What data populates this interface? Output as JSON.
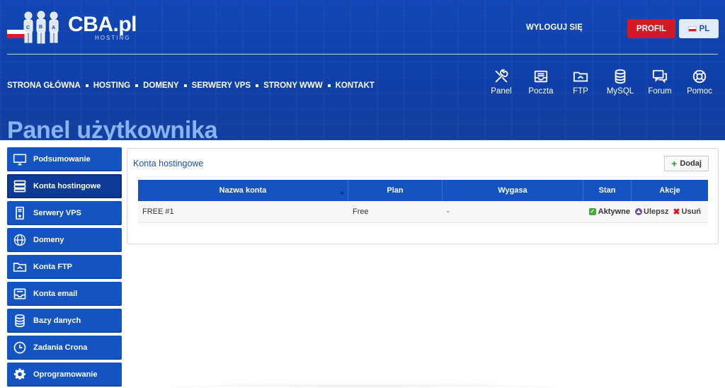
{
  "header": {
    "logo_text": "CBA.pl",
    "logo_sub": "HOSTING",
    "logout_label": "WYLOGUJ SIĘ",
    "profile_label": "PROFIL",
    "lang_label": "PL"
  },
  "nav": {
    "items": [
      "STRONA GŁÓWNA",
      "HOSTING",
      "DOMENY",
      "SERWERY VPS",
      "STRONY WWW",
      "KONTAKT"
    ]
  },
  "quick_links": [
    {
      "label": "Panel",
      "icon": "tools-icon"
    },
    {
      "label": "Poczta",
      "icon": "mail-icon"
    },
    {
      "label": "FTP",
      "icon": "folder-icon"
    },
    {
      "label": "MySQL",
      "icon": "database-icon"
    },
    {
      "label": "Forum",
      "icon": "chat-icon"
    },
    {
      "label": "Pomoc",
      "icon": "lifebuoy-icon"
    }
  ],
  "page_title": "Panel użytkownika",
  "sidebar": {
    "items": [
      {
        "label": "Podsumowanie",
        "icon": "monitor-icon"
      },
      {
        "label": "Konta hostingowe",
        "icon": "server-icon",
        "active": true
      },
      {
        "label": "Serwery VPS",
        "icon": "tower-icon"
      },
      {
        "label": "Domeny",
        "icon": "www-icon"
      },
      {
        "label": "Konta FTP",
        "icon": "folder-icon"
      },
      {
        "label": "Konta email",
        "icon": "mail-icon"
      },
      {
        "label": "Bazy danych",
        "icon": "database-icon"
      },
      {
        "label": "Zadania Crona",
        "icon": "clock-icon"
      },
      {
        "label": "Oprogramowanie",
        "icon": "gear-icon"
      }
    ]
  },
  "panel": {
    "title": "Konta hostingowe",
    "add_label": "Dodaj",
    "columns": [
      "Nazwa konta",
      "Plan",
      "Wygasa",
      "Stan",
      "Akcje"
    ],
    "rows": [
      {
        "name": "FREE #1",
        "plan": "Free",
        "expires": "-",
        "status": "Aktywne",
        "upgrade": "Ulepsz",
        "delete": "Usuń"
      }
    ]
  },
  "colors": {
    "header_blue": "#1347b5",
    "sidebar_blue": "#1453c2",
    "sidebar_active": "#0c3a94",
    "profile_red": "#d11a26",
    "title_light_blue": "#8ab4ef"
  }
}
